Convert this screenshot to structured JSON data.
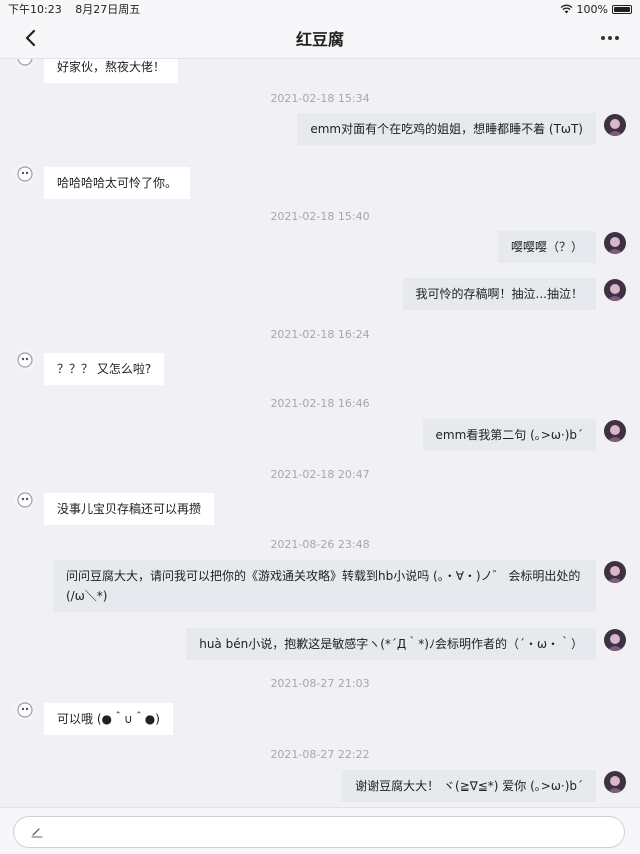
{
  "status_bar": {
    "time": "下午10:23",
    "date": "8月27日周五",
    "battery": "100%"
  },
  "header": {
    "title": "红豆腐"
  },
  "messages": [
    {
      "side": "in",
      "text": "好家伙，熬夜大佬！"
    },
    {
      "timestamp": "2021-02-18 15:34"
    },
    {
      "side": "out",
      "text": "emm对面有个在吃鸡的姐姐，想睡都睡不着 (TωT)"
    },
    {
      "side": "in",
      "text": "哈哈哈哈太可怜了你。"
    },
    {
      "timestamp": "2021-02-18 15:40"
    },
    {
      "side": "out",
      "text": "嘤嘤嘤（？）"
    },
    {
      "side": "out",
      "text": "我可怜的存稿啊！抽泣...抽泣！"
    },
    {
      "timestamp": "2021-02-18 16:24"
    },
    {
      "side": "in",
      "text": "？？？ 又怎么啦?"
    },
    {
      "timestamp": "2021-02-18 16:46"
    },
    {
      "side": "out",
      "text": "emm看我第二句 (｡>ω·)b´"
    },
    {
      "timestamp": "2021-02-18 20:47"
    },
    {
      "side": "in",
      "text": "没事儿宝贝存稿还可以再攒"
    },
    {
      "timestamp": "2021-08-26 23:48"
    },
    {
      "side": "out",
      "text": "问问豆腐大大，请问我可以把你的《游戏通关攻略》转载到hb小说吗 (。・∀・)ノ゛ 会标明出处的 (/ω＼*)"
    },
    {
      "side": "out",
      "text": "huà bén小说，抱歉这是敏感字ヽ(*´Д｀*)ﾉ会标明作者的（´・ω・｀）"
    },
    {
      "timestamp": "2021-08-27 21:03"
    },
    {
      "side": "in",
      "text": "可以哦 (●＾∪＾●)"
    },
    {
      "timestamp": "2021-08-27 22:22"
    },
    {
      "side": "out",
      "text": "谢谢豆腐大大！ ヾ(≧∇≦*) 爱你 (｡>ω·)b´"
    }
  ],
  "icons": {
    "back": "chevron-left-icon",
    "more": "more-icon",
    "wifi": "wifi-icon",
    "battery": "battery-icon",
    "compose": "pen-icon",
    "peer_avatar": "cartoon-avatar",
    "self_avatar": "girl-avatar"
  },
  "colors": {
    "background": "#f0f0f5",
    "incoming_bubble": "#ffffff",
    "outgoing_bubble": "#e6e9ee",
    "timestamp": "#a6a6ad"
  }
}
